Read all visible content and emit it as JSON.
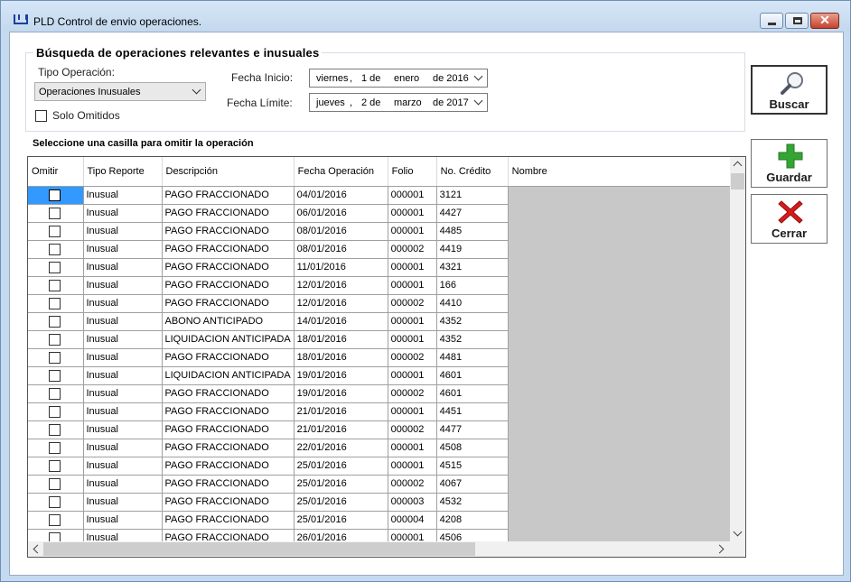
{
  "window": {
    "title": "PLD Control de envio operaciones."
  },
  "search": {
    "group_title": "Búsqueda de operaciones relevantes e inusuales",
    "tipo_label": "Tipo Operación:",
    "tipo_value": "Operaciones Inusuales",
    "solo_omitidos_label": "Solo Omitidos",
    "fecha_inicio_label": "Fecha Inicio:",
    "fecha_inicio": {
      "weekday": "viernes",
      "day": "1 de",
      "month": "enero",
      "year": "de 2016"
    },
    "fecha_limite_label": "Fecha Límite:",
    "fecha_limite": {
      "weekday": "jueves",
      "day": "2 de",
      "month": "marzo",
      "year": "de 2017"
    }
  },
  "hint": "Seleccione una casilla para omitir la operación",
  "grid": {
    "columns": [
      "Omitir",
      "Tipo Reporte",
      "Descripción",
      "Fecha Operación",
      "Folio",
      "No. Crédito",
      "Nombre"
    ],
    "rows": [
      [
        "Inusual",
        "PAGO FRACCIONADO",
        "04/01/2016",
        "000001",
        "3121"
      ],
      [
        "Inusual",
        "PAGO FRACCIONADO",
        "06/01/2016",
        "000001",
        "4427"
      ],
      [
        "Inusual",
        "PAGO FRACCIONADO",
        "08/01/2016",
        "000001",
        "4485"
      ],
      [
        "Inusual",
        "PAGO FRACCIONADO",
        "08/01/2016",
        "000002",
        "4419"
      ],
      [
        "Inusual",
        "PAGO FRACCIONADO",
        "11/01/2016",
        "000001",
        "4321"
      ],
      [
        "Inusual",
        "PAGO FRACCIONADO",
        "12/01/2016",
        "000001",
        "166"
      ],
      [
        "Inusual",
        "PAGO FRACCIONADO",
        "12/01/2016",
        "000002",
        "4410"
      ],
      [
        "Inusual",
        "ABONO ANTICIPADO",
        "14/01/2016",
        "000001",
        "4352"
      ],
      [
        "Inusual",
        "LIQUIDACION ANTICIPADA",
        "18/01/2016",
        "000001",
        "4352"
      ],
      [
        "Inusual",
        "PAGO FRACCIONADO",
        "18/01/2016",
        "000002",
        "4481"
      ],
      [
        "Inusual",
        "LIQUIDACION ANTICIPADA",
        "19/01/2016",
        "000001",
        "4601"
      ],
      [
        "Inusual",
        "PAGO FRACCIONADO",
        "19/01/2016",
        "000002",
        "4601"
      ],
      [
        "Inusual",
        "PAGO FRACCIONADO",
        "21/01/2016",
        "000001",
        "4451"
      ],
      [
        "Inusual",
        "PAGO FRACCIONADO",
        "21/01/2016",
        "000002",
        "4477"
      ],
      [
        "Inusual",
        "PAGO FRACCIONADO",
        "22/01/2016",
        "000001",
        "4508"
      ],
      [
        "Inusual",
        "PAGO FRACCIONADO",
        "25/01/2016",
        "000001",
        "4515"
      ],
      [
        "Inusual",
        "PAGO FRACCIONADO",
        "25/01/2016",
        "000002",
        "4067"
      ],
      [
        "Inusual",
        "PAGO FRACCIONADO",
        "25/01/2016",
        "000003",
        "4532"
      ],
      [
        "Inusual",
        "PAGO FRACCIONADO",
        "25/01/2016",
        "000004",
        "4208"
      ],
      [
        "Inusual",
        "PAGO FRACCIONADO",
        "26/01/2016",
        "000001",
        "4506"
      ]
    ]
  },
  "buttons": {
    "buscar": "Buscar",
    "guardar": "Guardar",
    "cerrar": "Cerrar"
  },
  "icons": {
    "buscar": "magnifier-icon",
    "guardar": "plus-icon",
    "cerrar": "red-x-icon"
  },
  "colors": {
    "selection": "#3399ff",
    "plus": "#2f9e2f",
    "x": "#d11a1a",
    "title_bg": "#c5daf0"
  }
}
